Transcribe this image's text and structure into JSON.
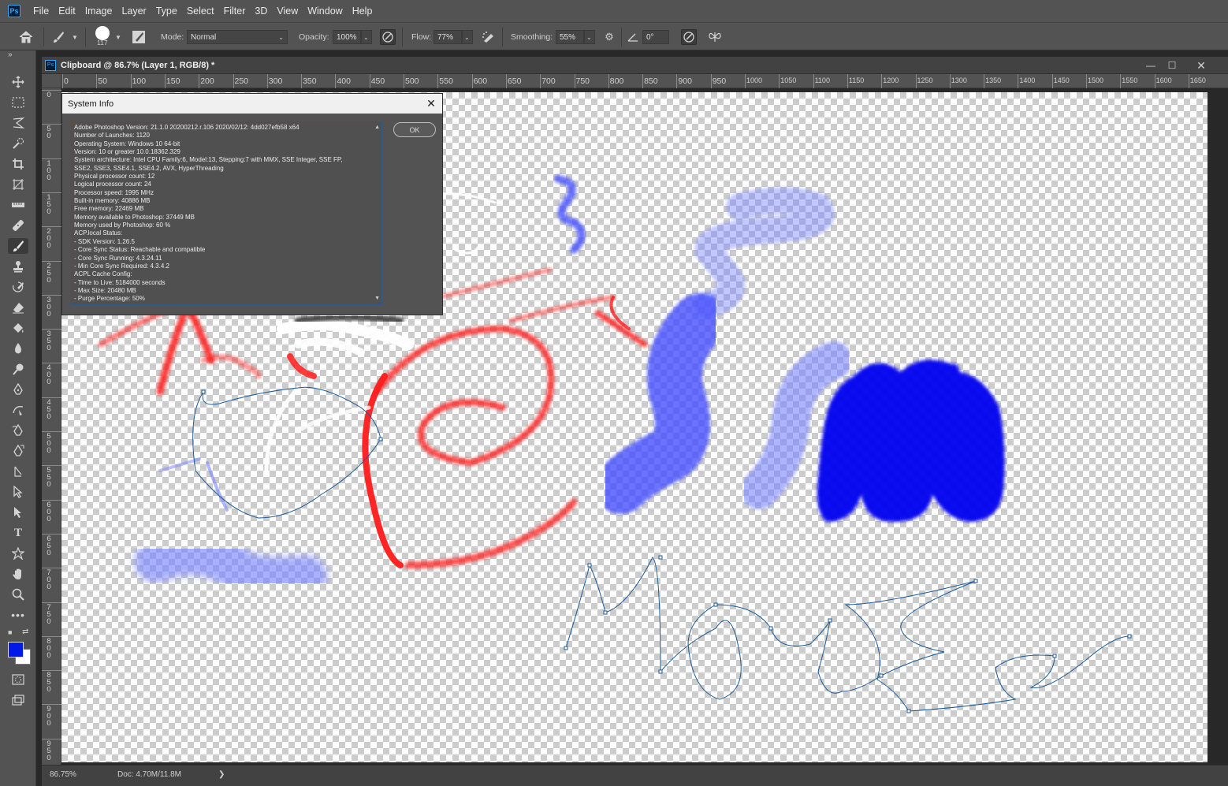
{
  "app": {
    "logo": "Ps"
  },
  "menubar": {
    "items": [
      "File",
      "Edit",
      "Image",
      "Layer",
      "Type",
      "Select",
      "Filter",
      "3D",
      "View",
      "Window",
      "Help"
    ]
  },
  "options": {
    "brush_size": "117",
    "mode_label": "Mode:",
    "mode_value": "Normal",
    "opacity_label": "Opacity:",
    "opacity_value": "100%",
    "flow_label": "Flow:",
    "flow_value": "77%",
    "smoothing_label": "Smoothing:",
    "smoothing_value": "55%",
    "angle_value": "0°",
    "icons": [
      "home-icon",
      "brush-icon",
      "brush-panel-icon",
      "pressure-opacity-icon",
      "airbrush-icon",
      "settings-icon",
      "angle-icon",
      "pressure-size-icon",
      "symmetry-icon"
    ]
  },
  "document": {
    "tab_title": "Clipboard @ 86.7% (Layer 1, RGB/8) *",
    "ruler_h": [
      "0",
      "50",
      "100",
      "150",
      "200",
      "250",
      "300",
      "350",
      "400",
      "450",
      "500",
      "550",
      "600",
      "650",
      "700",
      "750",
      "800",
      "850",
      "900",
      "950",
      "1000",
      "1050",
      "1100",
      "1150",
      "1200",
      "1250",
      "1300",
      "1350",
      "1400",
      "1450",
      "1500",
      "1550",
      "1600",
      "1650"
    ],
    "ruler_v": [
      "0",
      "50",
      "100",
      "150",
      "200",
      "250",
      "300",
      "350",
      "400",
      "450",
      "500",
      "550",
      "600",
      "650",
      "700",
      "750",
      "800",
      "850",
      "900",
      "950"
    ]
  },
  "status": {
    "zoom": "86.75%",
    "doc": "Doc: 4.70M/11.8M",
    "arrow": "❯"
  },
  "dialog": {
    "title": "System Info",
    "ok_label": "OK",
    "lines": [
      "Adobe Photoshop Version: 21.1.0 20200212.r.106 2020/02/12: 4dd027efb58  x64",
      "Number of Launches: 1120",
      "Operating System: Windows 10 64-bit",
      "Version: 10 or greater 10.0.18362.329",
      "System architecture: Intel CPU Family:6, Model:13, Stepping:7 with MMX, SSE Integer, SSE FP,",
      "SSE2, SSE3, SSE4.1, SSE4.2, AVX, HyperThreading",
      "Physical processor count: 12",
      "Logical processor count: 24",
      "Processor speed: 1995 MHz",
      "Built-in memory: 40886 MB",
      "Free memory: 22469 MB",
      "Memory available to Photoshop: 37449 MB",
      "Memory used by Photoshop: 60 %",
      "ACP.local Status:",
      " - SDK Version: 1.26.5",
      " - Core Sync Status: Reachable and compatible",
      " - Core Sync Running: 4.3.24.11",
      " - Min Core Sync Required: 4.3.4.2",
      "ACPL Cache Config:",
      " - Time to Live: 5184000 seconds",
      " - Max Size: 20480 MB",
      " - Purge Percentage: 50%"
    ]
  },
  "colors": {
    "foreground": "#0018e8",
    "background": "#ffffff"
  }
}
